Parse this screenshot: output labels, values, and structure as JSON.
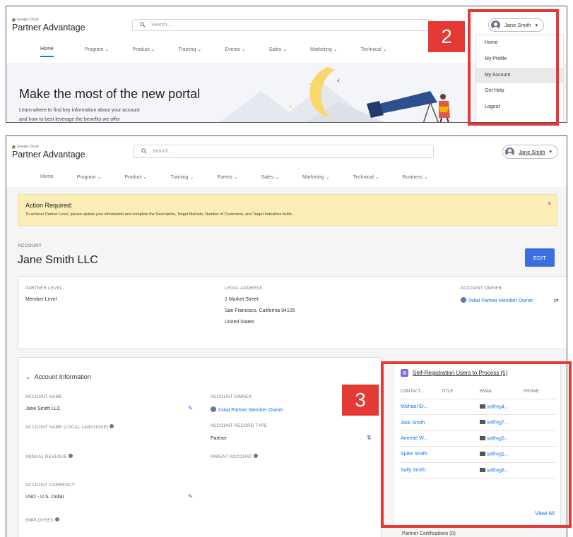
{
  "panel1": {
    "logo_small": "Google Cloud",
    "logo_main": "Partner Advantage",
    "search_placeholder": "Search...",
    "user_name": "Jane Smith",
    "nav": [
      "Home",
      "Program",
      "Product",
      "Training",
      "Events",
      "Sales",
      "Marketing",
      "Technical"
    ],
    "hero_title": "Make the most of the new portal",
    "hero_sub1": "Learn where to find key information about your account",
    "hero_sub2": "and how to best leverage the benefits we offer",
    "dropdown": [
      "Home",
      "My Profile",
      "My Account",
      "Get Help",
      "Logout"
    ],
    "dropdown_highlight": "My Account",
    "callout_number": "2"
  },
  "panel2": {
    "logo_small": "Google Cloud",
    "logo_main": "Partner Advantage",
    "search_placeholder": "Search...",
    "user_name": "Jane Smith",
    "nav": [
      "Home",
      "Program",
      "Product",
      "Training",
      "Events",
      "Sales",
      "Marketing",
      "Technical",
      "Business"
    ],
    "alert": {
      "title": "Action Required:",
      "body": "To achieve Partner Level, please update your information and complete the Description, Target Markets, Number of Customers, and Target Industries fields.",
      "close": "×"
    },
    "account_kicker": "ACCOUNT",
    "account_name": "Jane Smith LLC",
    "edit_label": "EDIT",
    "summary": {
      "partner_level_label": "PARTNER LEVEL",
      "partner_level_value": "Member Level",
      "legal_address_label": "LEGAL ADDRESS",
      "address_line1": "1 Market Street",
      "address_line2": "San Francisco, California 94105",
      "address_line3": "United States",
      "account_owner_label": "ACCOUNT OWNER",
      "account_owner_value": "Initial Partner Member Owner"
    },
    "info": {
      "section_title": "Account Information",
      "account_name_label": "ACCOUNT NAME",
      "account_name_value": "Jane Smith LLC",
      "account_owner_label": "ACCOUNT OWNER",
      "account_owner_value": "Initial Partner Member Owner",
      "local_name_label": "ACCOUNT NAME (LOCAL LANGUAGE)",
      "record_type_label": "ACCOUNT RECORD TYPE",
      "record_type_value": "Partner",
      "annual_revenue_label": "ANNUAL REVENUE",
      "parent_account_label": "PARENT ACCOUNT",
      "currency_label": "ACCOUNT CURRENCY",
      "currency_value": "USD - U.S. Dollar",
      "employees_label": "EMPLOYEES"
    },
    "self_reg": {
      "title": "Self-Registration Users to Process (5)",
      "columns": [
        "CONTACT...",
        "TITLE",
        "EMAIL",
        "PHONE"
      ],
      "rows": [
        {
          "contact": "Michael Er...",
          "email": "selfreg4..."
        },
        {
          "contact": "Jack Smith",
          "email": "selfreg7..."
        },
        {
          "contact": "Annette W...",
          "email": "selfreg5..."
        },
        {
          "contact": "Spike Smith",
          "email": "selfreg1..."
        },
        {
          "contact": "Sally Smith",
          "email": "selfreg8..."
        }
      ],
      "view_all": "View All"
    },
    "certifications": "Partner Certifications (0)",
    "callout_number": "3"
  },
  "colors": {
    "callout_red": "#e53935",
    "link_blue": "#1a73e8",
    "edit_button": "#3b6fe0",
    "alert_bg": "#fbedb6"
  }
}
